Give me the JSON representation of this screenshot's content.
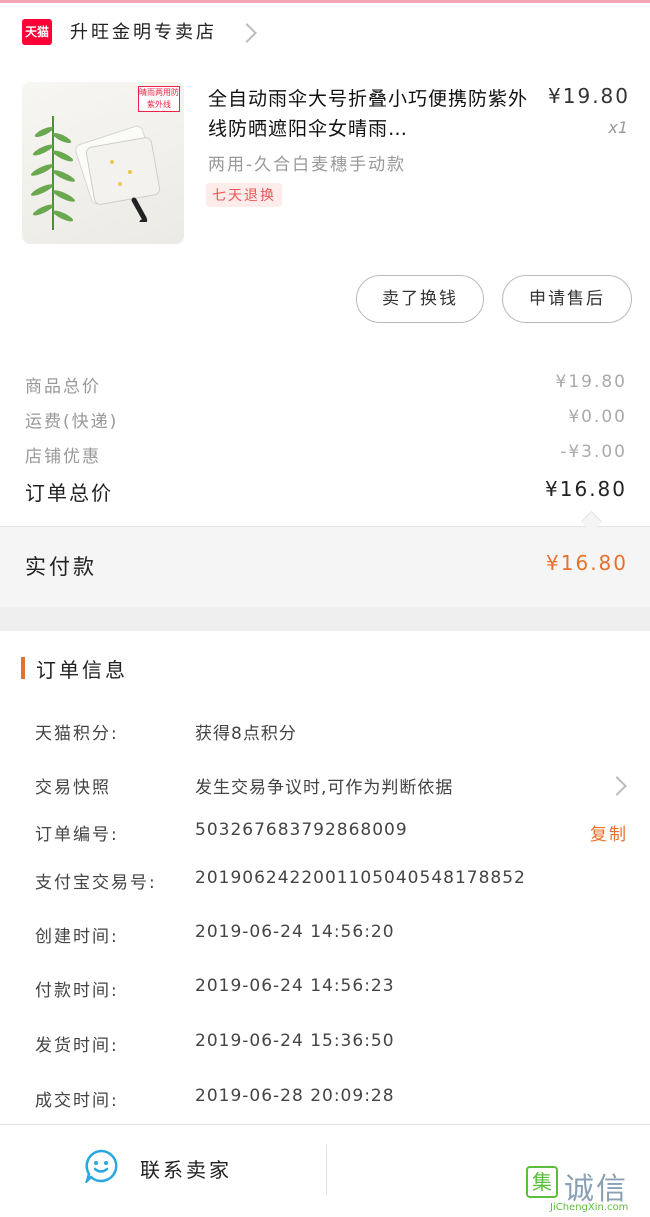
{
  "shop": {
    "logo_text": "天猫",
    "name": "升旺金明专卖店"
  },
  "product": {
    "image_badge": "晴雨两用防紫外线",
    "title": "全自动雨伞大号折叠小巧便携防紫外线防晒遮阳伞女晴雨…",
    "price": "¥19.80",
    "quantity": "x1",
    "spec": "两用-久合白麦穗手动款",
    "tag": "七天退换"
  },
  "actions": {
    "refund_label": "卖了换钱",
    "aftersale_label": "申请售后"
  },
  "summary": {
    "goods_total_label": "商品总价",
    "goods_total_value": "¥19.80",
    "shipping_label": "运费(快递)",
    "shipping_value": "¥0.00",
    "discount_label": "店铺优惠",
    "discount_value": "-¥3.00",
    "order_total_label": "订单总价",
    "order_total_value": "¥16.80",
    "paid_label": "实付款",
    "paid_value": "¥16.80"
  },
  "order_info": {
    "section_title": "订单信息",
    "rows": [
      {
        "label": "天猫积分:",
        "value": "获得8点积分"
      },
      {
        "label": "交易快照",
        "value": "发生交易争议时,可作为判断依据"
      },
      {
        "label": "订单编号:",
        "value": "503267683792868009",
        "action": "复制"
      },
      {
        "label": "支付宝交易号:",
        "value": "2019062422001105040548178852"
      },
      {
        "label": "创建时间:",
        "value": "2019-06-24 14:56:20"
      },
      {
        "label": "付款时间:",
        "value": "2019-06-24 14:56:23"
      },
      {
        "label": "发货时间:",
        "value": "2019-06-24 15:36:50"
      },
      {
        "label": "成交时间:",
        "value": "2019-06-28 20:09:28"
      }
    ]
  },
  "bottom_bar": {
    "contact_label": "联系卖家"
  },
  "watermark": {
    "box_char": "集",
    "text": "诚信",
    "url": "JiChengXin.com"
  },
  "colors": {
    "accent": "#e8712b",
    "tmall_red": "#ff0036",
    "contact_blue": "#2aa7e0"
  }
}
